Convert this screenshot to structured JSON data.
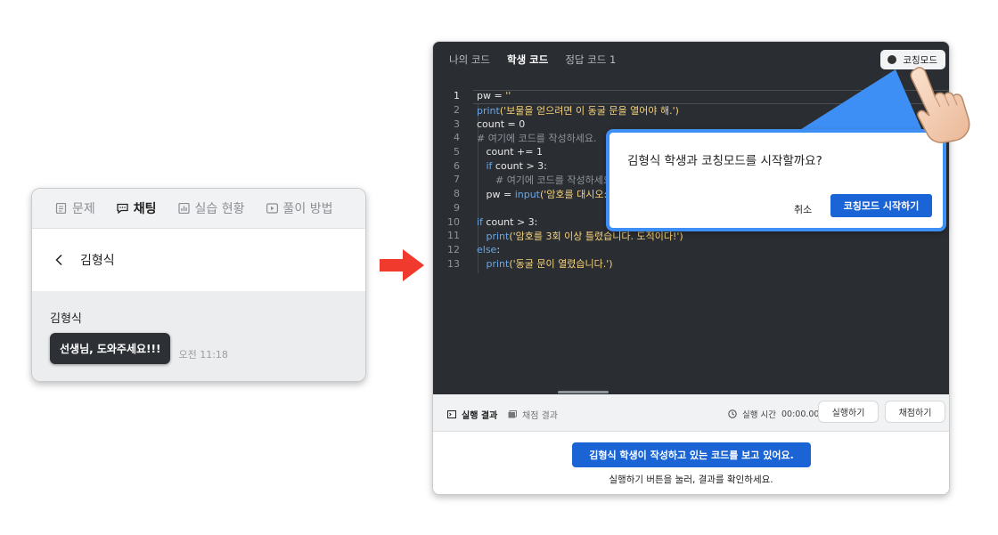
{
  "chat_panel": {
    "tabs": [
      {
        "label": "문제",
        "icon": "document-icon",
        "active": false
      },
      {
        "label": "채팅",
        "icon": "chat-icon",
        "active": true
      },
      {
        "label": "실습 현황",
        "icon": "chart-icon",
        "active": false
      },
      {
        "label": "풀이 방법",
        "icon": "play-icon",
        "active": false
      }
    ],
    "header_title": "김형식",
    "message": {
      "sender": "김형식",
      "text": "선생님, 도와주세요!!!",
      "time": "오전 11:18"
    }
  },
  "ide": {
    "tabs": [
      {
        "label": "나의 코드",
        "active": false
      },
      {
        "label": "학생 코드",
        "active": true
      },
      {
        "label": "정답 코드 1",
        "active": false
      }
    ],
    "coaching_button": "코칭모드",
    "code_lines": [
      {
        "n": "1",
        "parts": [
          [
            "t-op",
            "pw = "
          ],
          [
            "t-str",
            "''"
          ]
        ]
      },
      {
        "n": "2",
        "parts": [
          [
            "t-fn",
            "print"
          ],
          [
            "t-str",
            "('보물을 얻으려면 이 동굴 문을 열어야 해.')"
          ]
        ]
      },
      {
        "n": "3",
        "parts": [
          [
            "t-op",
            "count = 0"
          ]
        ]
      },
      {
        "n": "4",
        "parts": [
          [
            "t-cm",
            "# 여기에 코드를 작성하세요."
          ]
        ]
      },
      {
        "n": "5",
        "parts": [
          [
            "t-op",
            "   count += 1"
          ]
        ]
      },
      {
        "n": "6",
        "parts": [
          [
            "t-op",
            "   "
          ],
          [
            "t-kw",
            "if"
          ],
          [
            "t-op",
            " count > 3:"
          ]
        ]
      },
      {
        "n": "7",
        "parts": [
          [
            "t-cm",
            "      # 여기에 코드를 작성하세요."
          ]
        ]
      },
      {
        "n": "8",
        "parts": [
          [
            "t-op",
            "   pw = "
          ],
          [
            "t-fn",
            "input"
          ],
          [
            "t-str",
            "('암호를 대시오: ')"
          ]
        ]
      },
      {
        "n": "9",
        "parts": []
      },
      {
        "n": "10",
        "parts": [
          [
            "t-kw",
            "if"
          ],
          [
            "t-op",
            " count > 3:"
          ]
        ]
      },
      {
        "n": "11",
        "parts": [
          [
            "t-op",
            "   "
          ],
          [
            "t-fn",
            "print"
          ],
          [
            "t-str",
            "('암호를 3회 이상 틀렸습니다. 도적이다!')"
          ]
        ]
      },
      {
        "n": "12",
        "parts": [
          [
            "t-kw",
            "else"
          ],
          [
            "t-op",
            ":"
          ]
        ]
      },
      {
        "n": "13",
        "parts": [
          [
            "t-op",
            "   "
          ],
          [
            "t-fn",
            "print"
          ],
          [
            "t-str",
            "('동굴 문이 열렸습니다.')"
          ]
        ]
      }
    ],
    "run_bar": {
      "tab_result": "실행 결과",
      "tab_grading": "채점 결과",
      "run_time_label": "실행 시간",
      "run_time_value": "00:00.00",
      "run_button": "실행하기",
      "grade_button": "채점하기"
    },
    "output": {
      "badge": "김형식 학생이 작성하고 있는 코드를 보고 있어요.",
      "hint": "실행하기 버튼을 눌러, 결과를 확인하세요."
    }
  },
  "dialog": {
    "question": "김형식 학생과 코칭모드를 시작할까요?",
    "cancel": "취소",
    "confirm": "코칭모드 시작하기"
  },
  "colors": {
    "accent_blue": "#1b64d5",
    "callout_blue": "#3e8ff5",
    "arrow_red": "#f03a2e",
    "editor_bg": "#2a2d31"
  }
}
